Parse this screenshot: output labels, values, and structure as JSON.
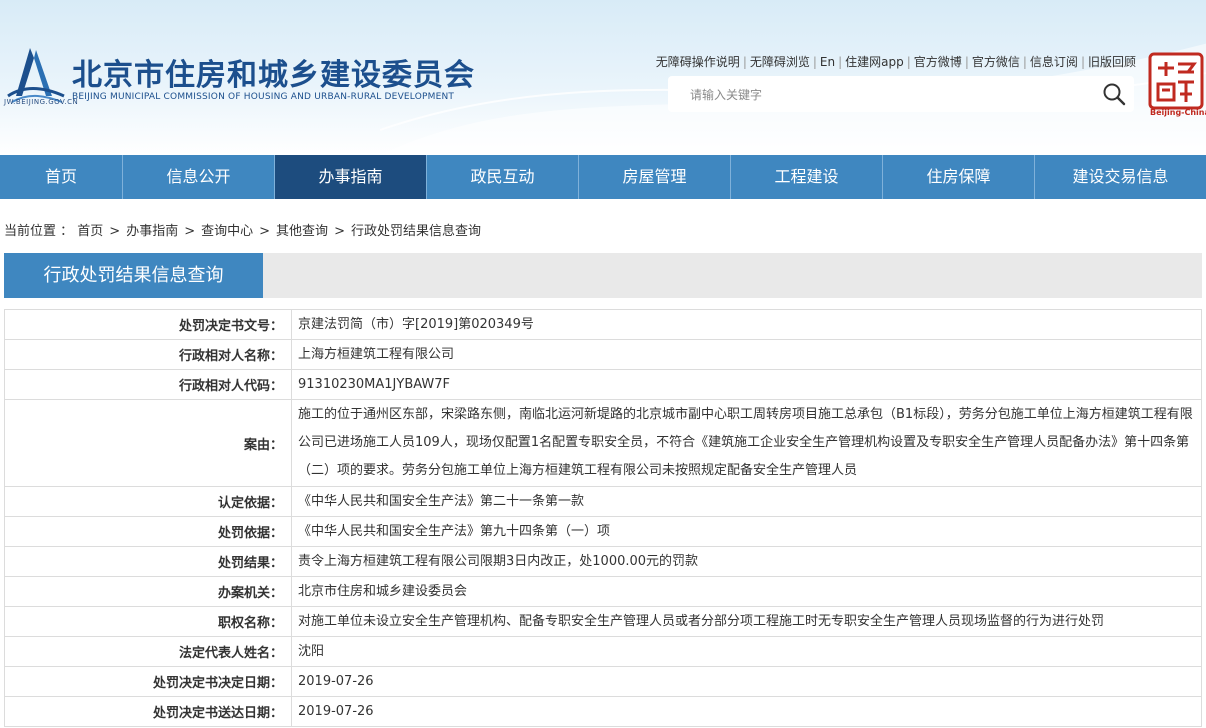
{
  "header": {
    "title": "北京市住房和城乡建设委员会",
    "subtitle": "BEIJING MUNICIPAL COMMISSION OF HOUSING AND URBAN-RURAL DEVELOPMENT",
    "logo_url_text": "JW.BEIJING.GOV.CN",
    "top_links": [
      "无障碍操作说明",
      "无障碍浏览",
      "En",
      "住建网app",
      "官方微博",
      "官方微信",
      "信息订阅",
      "旧版回顾"
    ],
    "search_placeholder": "请输入关键字",
    "seal_caption": "Beijing-China",
    "brand_color": "#1c4f8d"
  },
  "nav": {
    "items": [
      {
        "label": "首页",
        "active": false
      },
      {
        "label": "信息公开",
        "active": false
      },
      {
        "label": "办事指南",
        "active": true
      },
      {
        "label": "政民互动",
        "active": false
      },
      {
        "label": "房屋管理",
        "active": false
      },
      {
        "label": "工程建设",
        "active": false
      },
      {
        "label": "住房保障",
        "active": false
      },
      {
        "label": "建设交易信息",
        "active": false
      }
    ],
    "bg_color": "#3f87c0",
    "active_color": "#1d4c7e"
  },
  "breadcrumb": {
    "prefix": "当前位置 ：",
    "items": [
      "首页",
      "办事指南",
      "查询中心",
      "其他查询",
      "行政处罚结果信息查询"
    ]
  },
  "section": {
    "title": "行政处罚结果信息查询"
  },
  "details": [
    {
      "label": "处罚决定书文号：",
      "value": "京建法罚简（市）字[2019]第020349号"
    },
    {
      "label": "行政相对人名称：",
      "value": "上海方桓建筑工程有限公司"
    },
    {
      "label": "行政相对人代码：",
      "value": "91310230MA1JYBAW7F"
    },
    {
      "label": "案由：",
      "value": "施工的位于通州区东部，宋梁路东侧，南临北运河新堤路的北京城市副中心职工周转房项目施工总承包（B1标段），劳务分包施工单位上海方桓建筑工程有限公司已进场施工人员109人，现场仅配置1名配置专职安全员，不符合《建筑施工企业安全生产管理机构设置及专职安全生产管理人员配备办法》第十四条第（二）项的要求。劳务分包施工单位上海方桓建筑工程有限公司未按照规定配备安全生产管理人员"
    },
    {
      "label": "认定依据：",
      "value": "《中华人民共和国安全生产法》第二十一条第一款"
    },
    {
      "label": "处罚依据：",
      "value": "《中华人民共和国安全生产法》第九十四条第（一）项"
    },
    {
      "label": "处罚结果：",
      "value": "责令上海方桓建筑工程有限公司限期3日内改正，处1000.00元的罚款"
    },
    {
      "label": "办案机关：",
      "value": "北京市住房和城乡建设委员会"
    },
    {
      "label": "职权名称：",
      "value": "对施工单位未设立安全生产管理机构、配备专职安全生产管理人员或者分部分项工程施工时无专职安全生产管理人员现场监督的行为进行处罚"
    },
    {
      "label": "法定代表人姓名：",
      "value": "沈阳"
    },
    {
      "label": "处罚决定书决定日期：",
      "value": "2019-07-26"
    },
    {
      "label": "处罚决定书送达日期：",
      "value": "2019-07-26"
    }
  ]
}
